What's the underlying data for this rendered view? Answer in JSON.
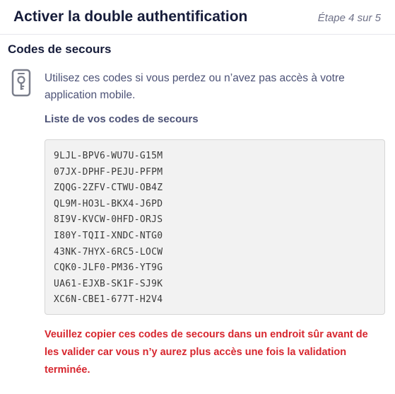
{
  "header": {
    "title": "Activer la double authentification",
    "step": "Étape 4 sur 5"
  },
  "section": {
    "title": "Codes de secours",
    "icon": "phone-lock-icon",
    "intro": "Utilisez ces codes si vous perdez ou n’avez pas accès à votre application mobile.",
    "list_title": "Liste de vos codes de secours"
  },
  "codes": [
    "9LJL-BPV6-WU7U-G15M",
    "07JX-DPHF-PEJU-PFPM",
    "ZQQG-2ZFV-CTWU-OB4Z",
    "QL9M-HO3L-BKX4-J6PD",
    "8I9V-KVCW-0HFD-ORJS",
    "I80Y-TQII-XNDC-NTG0",
    "43NK-7HYX-6RC5-LOCW",
    "CQK0-JLF0-PM36-YT9G",
    "UA61-EJXB-SK1F-SJ9K",
    "XC6N-CBE1-677T-H2V4"
  ],
  "warning": "Veuillez copier ces codes de secours dans un endroit sûr avant de les valider car vous n’y aurez plus accès une fois la validation terminée.",
  "colors": {
    "heading": "#161c3a",
    "body_text": "#4c5276",
    "muted": "#6e7188",
    "warning": "#d7262e",
    "codes_background": "#f2f2f2"
  }
}
